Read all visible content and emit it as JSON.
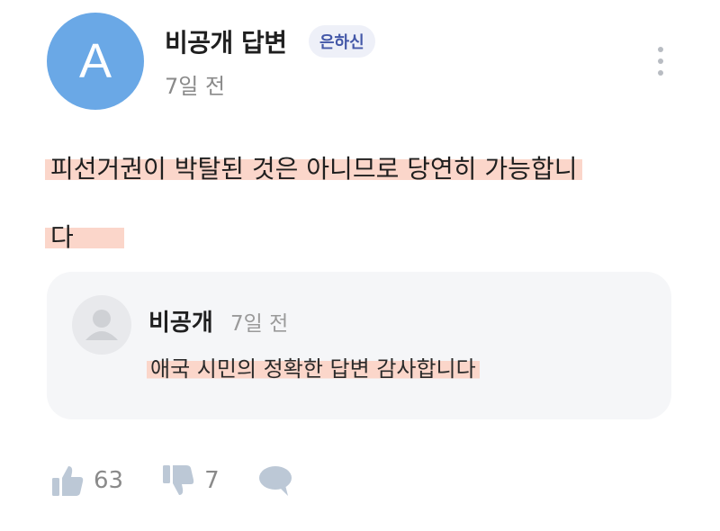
{
  "author": {
    "avatar_letter": "A",
    "name": "비공개 답변",
    "badge": "은하신",
    "time": "7일 전"
  },
  "answer": {
    "text_line1": "피선거권이 박탈된 것은 아니므로 당연히 가능합니",
    "text_line2": "다"
  },
  "reply": {
    "name": "비공개",
    "time": "7일 전",
    "text": "애국 시민의 정확한 답변 감사합니다"
  },
  "actions": {
    "like_count": "63",
    "dislike_count": "7"
  },
  "icons": {
    "like": "thumbs-up-icon",
    "dislike": "thumbs-down-icon",
    "comment": "comment-bubble-icon",
    "more": "more-vertical-icon",
    "reply_avatar": "default-user-icon"
  },
  "colors": {
    "avatar_bg": "#6aa8e6",
    "badge_bg": "#eef0f8",
    "badge_text": "#4458a8",
    "highlight": "#fbd6ca",
    "card_bg": "#f5f6f8",
    "icon_gray": "#bcc8d6"
  }
}
